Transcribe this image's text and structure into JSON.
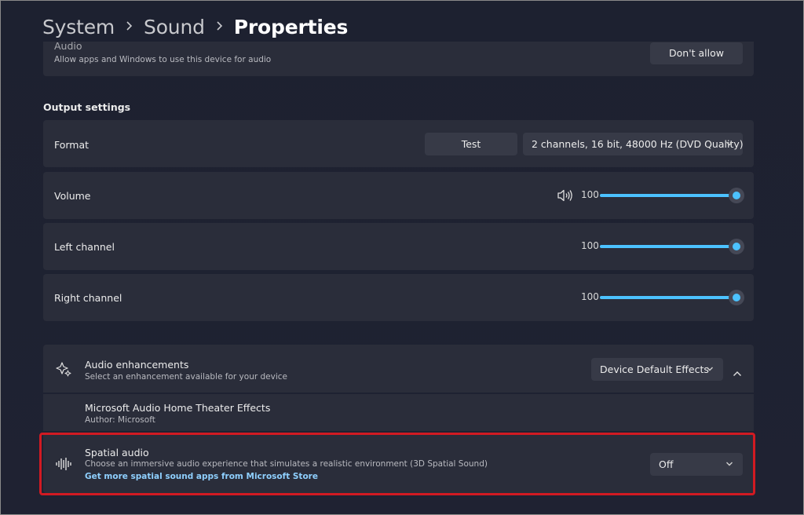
{
  "breadcrumb": {
    "items": [
      "System",
      "Sound",
      "Properties"
    ]
  },
  "audio_access": {
    "title": "Audio",
    "subtitle": "Allow apps and Windows to use this device for audio",
    "button_label": "Don't allow"
  },
  "output_settings": {
    "heading": "Output settings",
    "format": {
      "label": "Format",
      "test_label": "Test",
      "selected": "2 channels, 16 bit, 48000 Hz (DVD Quality)"
    },
    "volume": {
      "label": "Volume",
      "value": "100",
      "level": 1.0
    },
    "left_channel": {
      "label": "Left channel",
      "value": "100",
      "level": 1.0
    },
    "right_channel": {
      "label": "Right channel",
      "value": "100",
      "level": 1.0
    }
  },
  "enhancements": {
    "title": "Audio enhancements",
    "subtitle": "Select an enhancement available for your device",
    "selected": "Device Default Effects",
    "effect": {
      "title": "Microsoft Audio Home Theater Effects",
      "author": "Author: Microsoft"
    }
  },
  "spatial_audio": {
    "title": "Spatial audio",
    "subtitle": "Choose an immersive audio experience that simulates a realistic environment (3D Spatial Sound)",
    "link": "Get more spatial sound apps from Microsoft Store",
    "selected": "Off"
  },
  "colors": {
    "accent": "#4cc2ff",
    "highlight_border": "#d11a22",
    "card_bg": "#2a2d3a",
    "page_bg": "#1f2232"
  },
  "icons": {
    "speaker": "speaker-icon",
    "enhancements": "sparkle-icon",
    "spatial": "waveform-icon",
    "chevron_down": "chevron-down-icon",
    "chevron_up": "chevron-up-icon",
    "chevron_right": "chevron-right-icon"
  }
}
